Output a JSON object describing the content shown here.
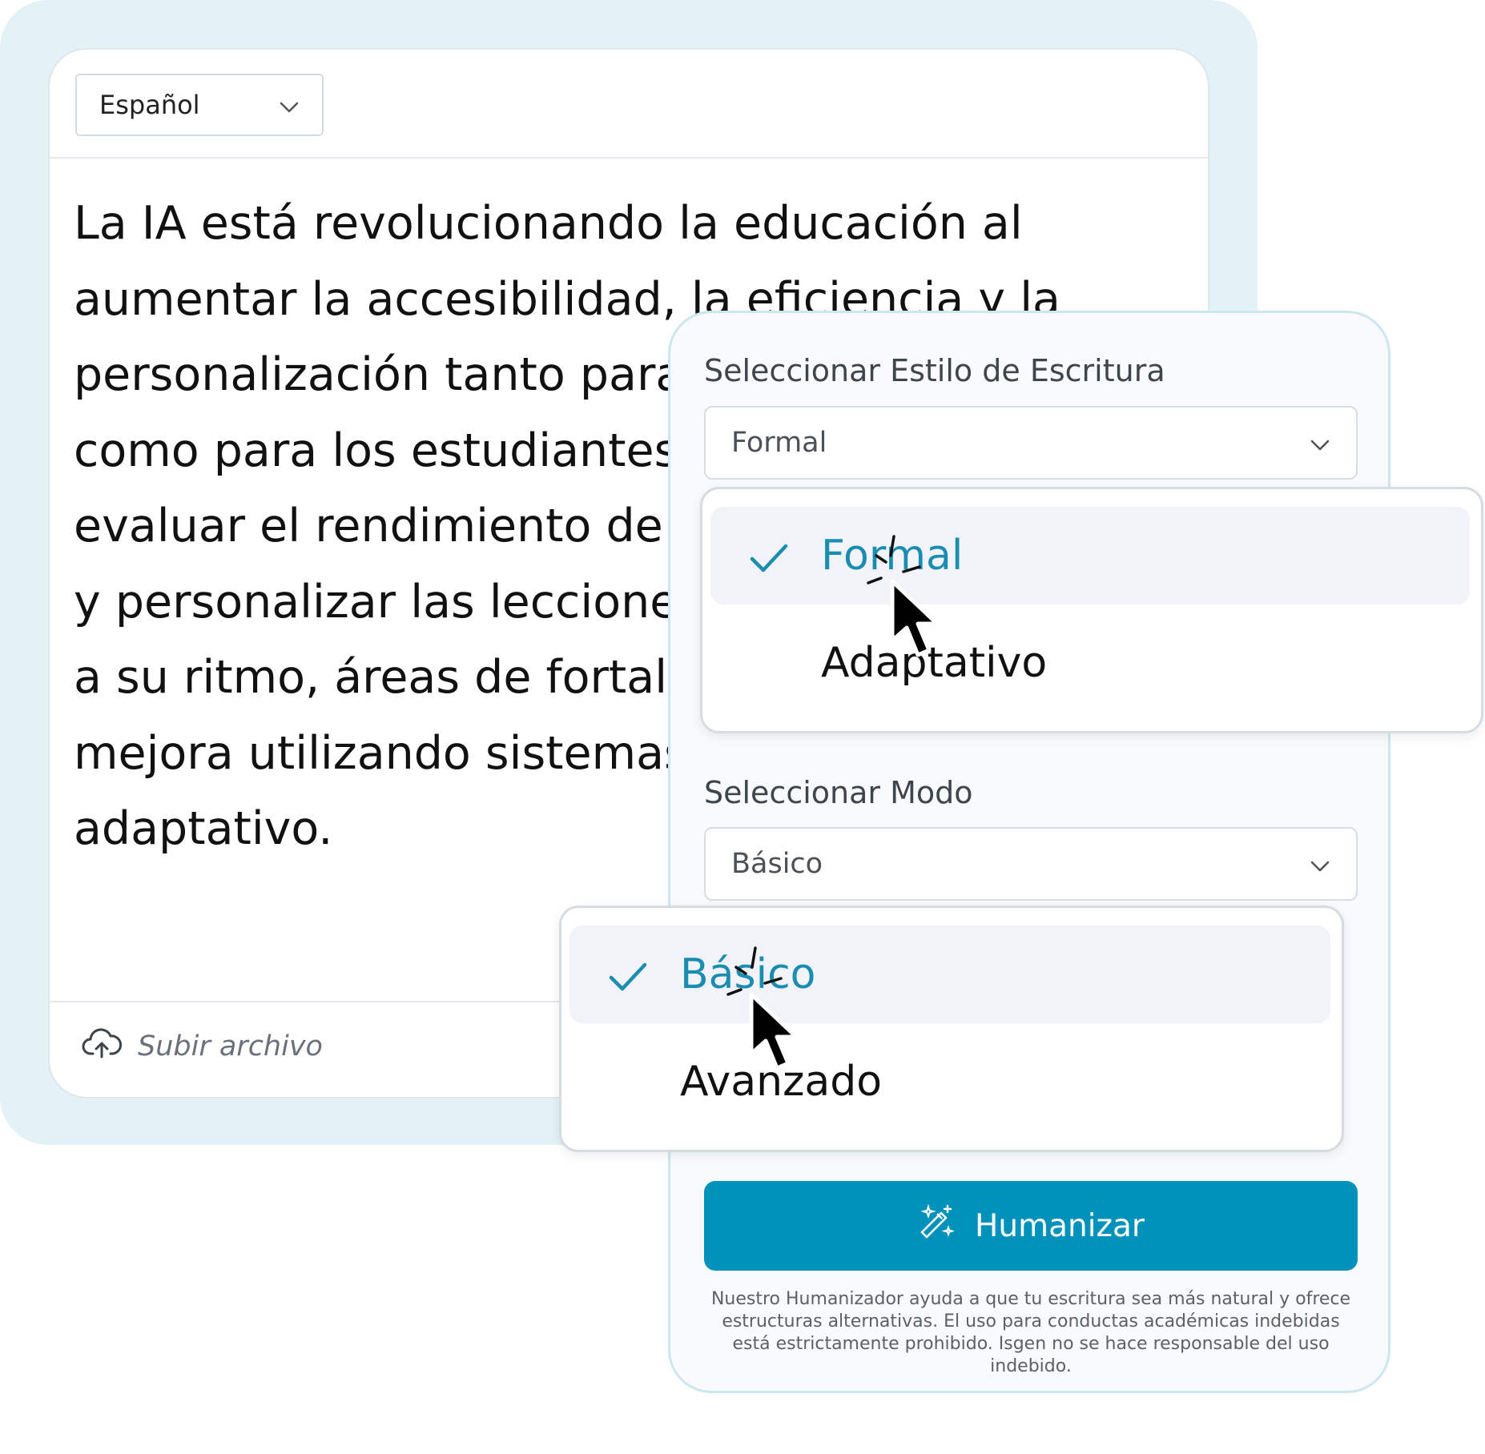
{
  "editor": {
    "language_select": {
      "value": "Español",
      "icon": "chevron-down-icon"
    },
    "text": "La IA está revolucionando la educación al\naumentar la accesibilidad, la eficiencia y la\npersonalización tanto para los profesores\ncomo para los estudiantes. Puede\nevaluar el rendimiento de los alumnos\ny personalizar las lecciones adaptadas\na su ritmo, áreas de fortaleza y\nmejora utilizando sistemas de aprendizaje\nadaptativo.",
    "upload": {
      "label": "Subir archivo",
      "icon": "cloud-upload-icon"
    }
  },
  "panel": {
    "style": {
      "label": "Seleccionar Estilo de Escritura",
      "value": "Formal",
      "options": [
        {
          "label": "Formal",
          "selected": true
        },
        {
          "label": "Adaptativo",
          "selected": false
        }
      ]
    },
    "mode": {
      "label": "Seleccionar Modo",
      "value": "Básico",
      "options": [
        {
          "label": "Básico",
          "selected": true
        },
        {
          "label": "Avanzado",
          "selected": false
        }
      ]
    },
    "humanize_button": {
      "label": "Humanizar",
      "icon": "magic-wand-icon"
    },
    "disclaimer": "Nuestro Humanizador ayuda a que tu escritura sea más natural y ofrece estructuras alternativas. El uso para conductas académicas indebidas está estrictamente prohibido. Isgen no se hace responsable del uso indebido."
  },
  "colors": {
    "accent": "#0092bb",
    "selected_text": "#1b8db0",
    "frame_bg": "#e3f2f6",
    "panel_border": "#cde7f0"
  }
}
